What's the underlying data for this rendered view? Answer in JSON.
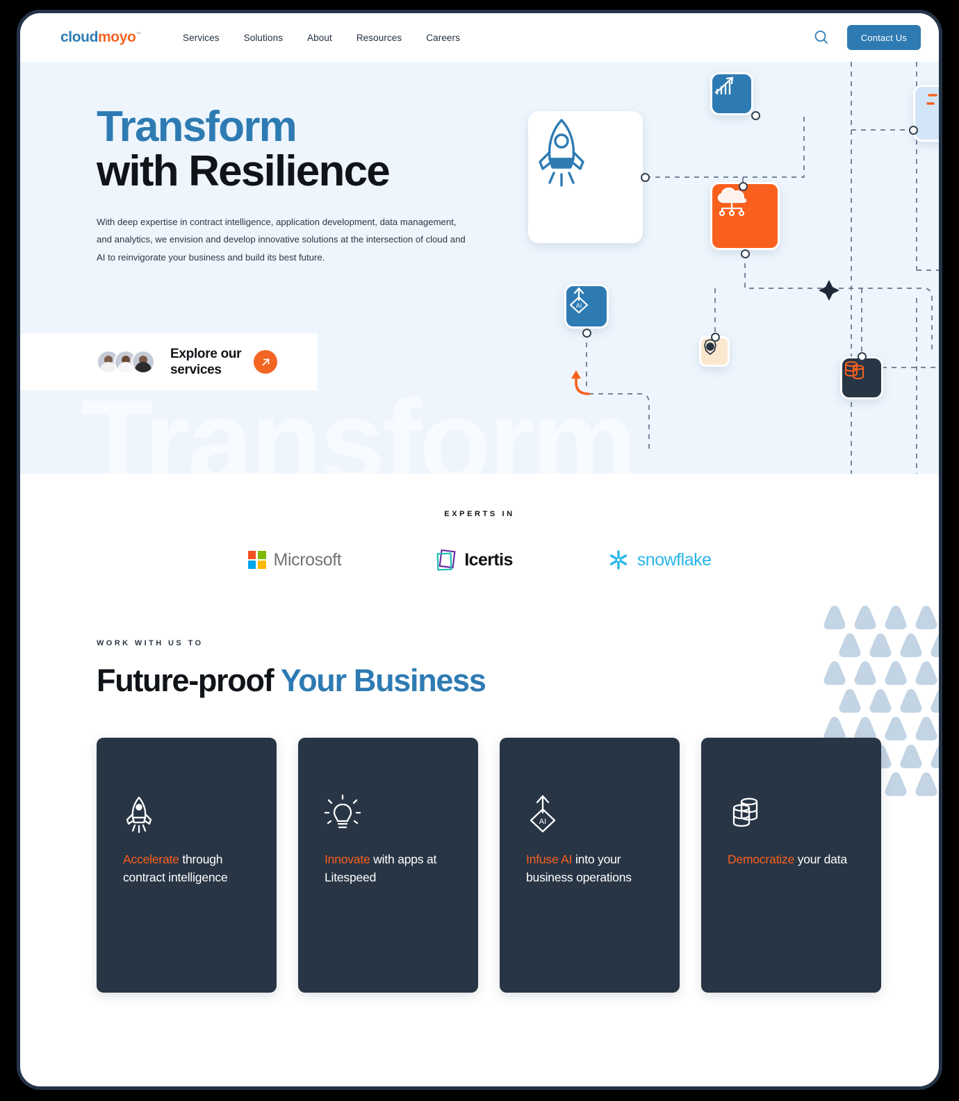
{
  "nav": {
    "logo": {
      "part1": "cloud",
      "part2": "moyo",
      "tm": "™"
    },
    "links": [
      {
        "label": "Services"
      },
      {
        "label": "Solutions"
      },
      {
        "label": "About"
      },
      {
        "label": "Resources"
      },
      {
        "label": "Careers"
      }
    ],
    "search_icon": "search-icon",
    "contact_label": "Contact Us"
  },
  "hero": {
    "watermark": "Transform",
    "title_line1": "Transform",
    "title_line2": "with Resilience",
    "paragraph": "With deep expertise in contract intelligence, application development, data management, and analytics, we envision and develop innovative solutions at the intersection of cloud and AI to reinvigorate your business and build its best future.",
    "explore_line1": "Explore our",
    "explore_line2": "services",
    "explore_arrow_icon": "arrow-up-right-icon",
    "graphic_cards": [
      {
        "name": "rocket-card",
        "icon": "rocket-icon",
        "color": "#ffffff"
      },
      {
        "name": "growth-chart-card",
        "icon": "chart-growth-icon",
        "color": "#2e7bb3"
      },
      {
        "name": "cloud-network-card",
        "icon": "cloud-network-icon",
        "color": "#f9601d"
      },
      {
        "name": "ai-card",
        "icon": "ai-diamond-icon",
        "color": "#2e7bb3"
      },
      {
        "name": "security-card",
        "icon": "security-gear-icon",
        "color": "#fce7cf"
      },
      {
        "name": "database-card",
        "icon": "database-icon",
        "color": "#283545"
      },
      {
        "name": "edge-card",
        "icon": "spark-icon",
        "color": "#d3e6f8"
      }
    ]
  },
  "experts": {
    "label": "EXPERTS IN",
    "partners": [
      {
        "name": "Microsoft",
        "icon": "microsoft-logo"
      },
      {
        "name": "Icertis",
        "icon": "icertis-logo"
      },
      {
        "name": "snowflake",
        "icon": "snowflake-logo"
      }
    ]
  },
  "future_proof": {
    "eyebrow": "WORK WITH US TO",
    "title_dark": "Future-proof",
    "title_blue": "Your Business",
    "cards": [
      {
        "icon": "rocket-icon",
        "highlight": "Accelerate",
        "rest": " through contract intelligence"
      },
      {
        "icon": "lightbulb-icon",
        "highlight": "Innovate",
        "rest": " with apps at Litespeed"
      },
      {
        "icon": "ai-diamond-icon",
        "highlight": "Infuse AI",
        "rest": " into your business operations"
      },
      {
        "icon": "database-icon",
        "highlight": "Democratize",
        "rest": " your data"
      }
    ]
  },
  "colors": {
    "brand_blue": "#2e7bb3",
    "brand_orange": "#f26522",
    "accent_orange": "#f9601d",
    "dark_navy": "#283545",
    "hero_bg": "#eef5fd",
    "pattern": "#c3d4e4"
  }
}
